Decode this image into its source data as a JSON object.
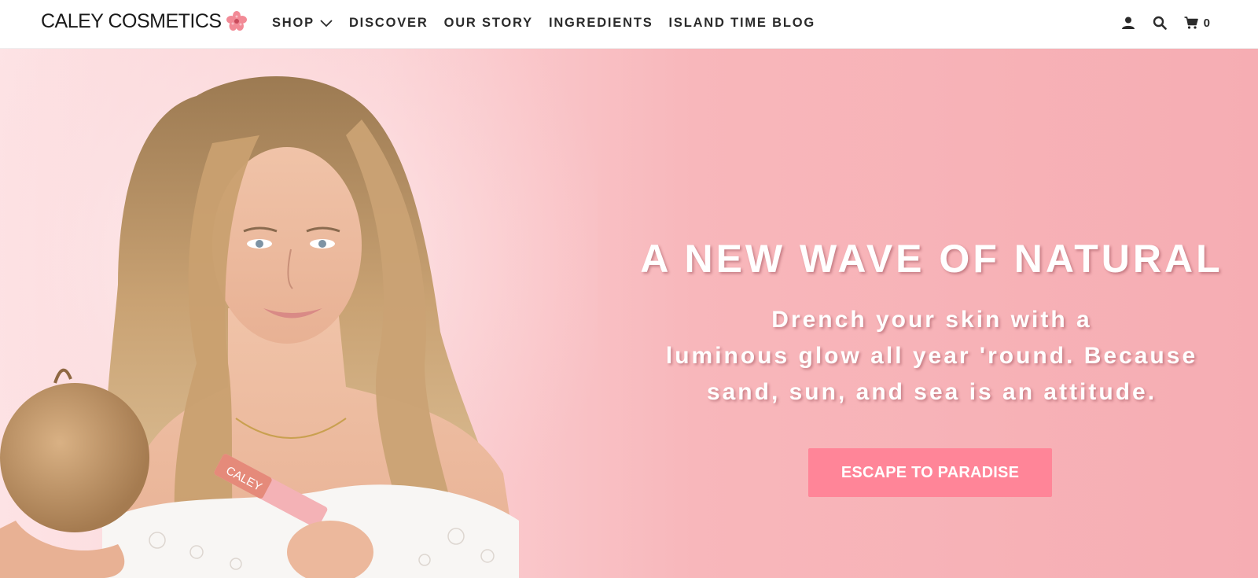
{
  "brand": {
    "name": "CALEY COSMETICS",
    "logo_icon": "hibiscus-flower-icon",
    "accent_color": "#ff8598"
  },
  "nav": {
    "items": [
      {
        "label": "SHOP",
        "has_dropdown": true
      },
      {
        "label": "DISCOVER"
      },
      {
        "label": "OUR STORY"
      },
      {
        "label": "INGREDIENTS"
      },
      {
        "label": "ISLAND TIME BLOG"
      }
    ]
  },
  "header_actions": {
    "account_icon": "user-icon",
    "search_icon": "search-icon",
    "cart_icon": "cart-icon",
    "cart_count": "0"
  },
  "hero": {
    "heading": "A NEW WAVE OF NATURAL",
    "subheading_lines": [
      "Drench your skin with a",
      "luminous glow all year 'round. Because",
      "sand, sun, and sea is an attitude."
    ],
    "cta_label": "ESCAPE TO PARADISE",
    "product_label": "CALEY"
  }
}
